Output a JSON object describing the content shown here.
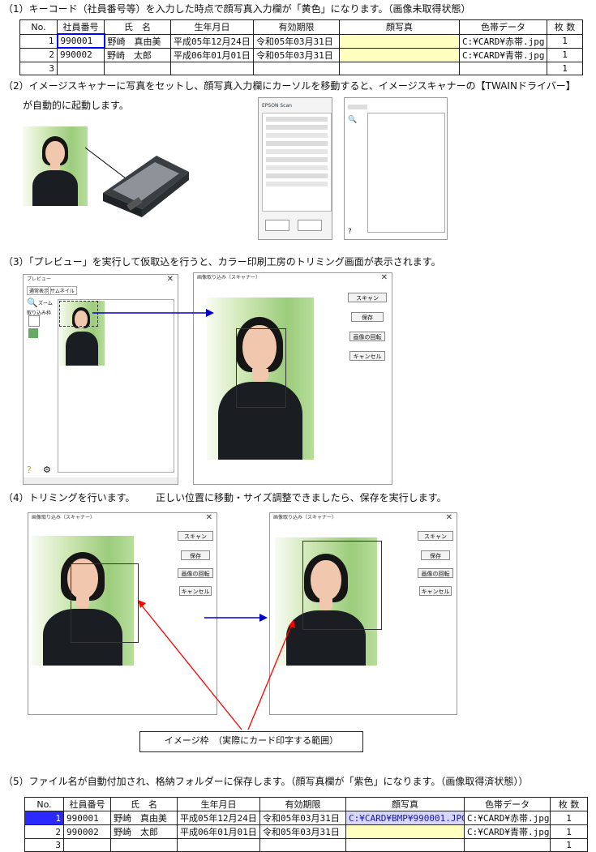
{
  "steps": {
    "s1": "（1）キーコード（社員番号等）を入力した時点で顔写真入力欄が「黄色」になります。（画像未取得状態）",
    "s2a": "（2）イメージスキャナーに写真をセットし、顔写真入力欄にカーソルを移動すると、イメージスキャナーの【TWAINドライバー】",
    "s2b": "が自動的に起動します。",
    "s3": "（3）「プレビュー」を実行して仮取込を行うと、カラー印刷工房のトリミング画面が表示されます。",
    "s4a": "（4）トリミングを行います。",
    "s4b": "正しい位置に移動・サイズ調整できましたら、保存を実行します。",
    "s5": "（5）ファイル名が自動付加され、格納フォルダーに保存します。（顔写真欄が「紫色」になります。（画像取得済状態））"
  },
  "table_headers": [
    "No.",
    "社員番号",
    "氏　名",
    "生年月日",
    "有効期限",
    "顔写真",
    "色帯データ",
    "枚 数"
  ],
  "table1": {
    "rows": [
      {
        "no": "1",
        "id": "990001",
        "name": "野崎　真由美",
        "birth": "平成05年12月24日",
        "expiry": "令和05年03月31日",
        "photo": "",
        "color": "C:¥CARD¥赤帯.jpg",
        "count": "1"
      },
      {
        "no": "2",
        "id": "990002",
        "name": "野崎　太郎",
        "birth": "平成06年01月01日",
        "expiry": "令和05年03月31日",
        "photo": "",
        "color": "C:¥CARD¥青帯.jpg",
        "count": "1"
      },
      {
        "no": "3",
        "id": "",
        "name": "",
        "birth": "",
        "expiry": "",
        "photo": "",
        "color": "",
        "count": "1"
      }
    ]
  },
  "table2": {
    "rows": [
      {
        "no": "1",
        "id": "990001",
        "name": "野崎　真由美",
        "birth": "平成05年12月24日",
        "expiry": "令和05年03月31日",
        "photo": "C:¥CARD¥BMP¥990001.JPG",
        "color": "C:¥CARD¥赤帯.jpg",
        "count": "1"
      },
      {
        "no": "2",
        "id": "990002",
        "name": "野崎　太郎",
        "birth": "平成06年01月01日",
        "expiry": "令和05年03月31日",
        "photo": "",
        "color": "C:¥CARD¥青帯.jpg",
        "count": "1"
      },
      {
        "no": "3",
        "id": "",
        "name": "",
        "birth": "",
        "expiry": "",
        "photo": "",
        "color": "",
        "count": "1"
      }
    ]
  },
  "scan_window": {
    "title": "画像取り込み（スキャナー）",
    "scan": "スキャン",
    "save": "保存",
    "rotate": "画像の回転",
    "cancel": "キャンセル"
  },
  "preview_window": {
    "title": "プレビュー",
    "tab1": "通常表示",
    "tab2": "サムネイル",
    "zoom": "ズーム",
    "import": "取り込み枠"
  },
  "epson": {
    "logo": "EPSON Scan"
  },
  "caption": "イメージ枠　（実際にカード印字する範囲）",
  "colors": {
    "yellow": "#ffffc0",
    "purple": "#d6d6ff",
    "select": "#2a2aff",
    "arrow_red": "#ff0000",
    "arrow_blue": "#0000cc"
  }
}
